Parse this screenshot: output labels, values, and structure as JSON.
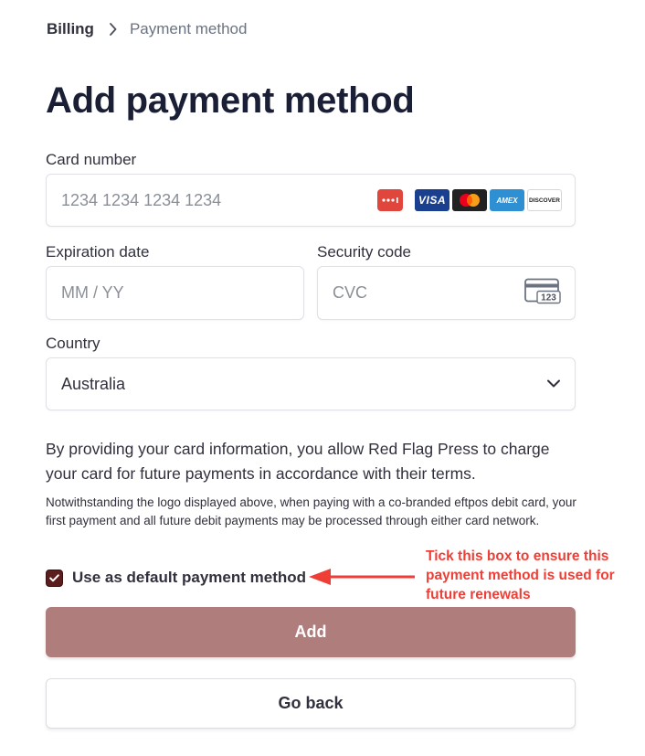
{
  "breadcrumb": {
    "root": "Billing",
    "current": "Payment method"
  },
  "page": {
    "title": "Add payment method"
  },
  "card_number": {
    "label": "Card number",
    "placeholder": "1234 1234 1234 1234",
    "brand_icons": [
      "eftpos-icon",
      "visa-icon",
      "mastercard-icon",
      "amex-icon",
      "discover-icon"
    ],
    "visa_text": "VISA",
    "amex_text": "AMEX",
    "discover_text": "DISCOVER"
  },
  "expiration": {
    "label": "Expiration date",
    "placeholder": "MM / YY"
  },
  "security_code": {
    "label": "Security code",
    "placeholder": "CVC",
    "icon_text": "123"
  },
  "country": {
    "label": "Country",
    "value": "Australia"
  },
  "terms": {
    "main": "By providing your card information, you allow Red Flag Press to charge your card for future payments in accordance with their terms.",
    "small": "Notwithstanding the logo displayed above, when paying with a co-branded eftpos debit card, your first payment and all future debit payments may be processed through either card network."
  },
  "default_checkbox": {
    "label": "Use as default payment method",
    "checked": true
  },
  "annotation": {
    "text": "Tick this box to ensure this payment method is used for future renewals",
    "color": "#ef3e36"
  },
  "buttons": {
    "add": "Add",
    "back": "Go back"
  },
  "colors": {
    "add_button": "#b07d7d",
    "checkbox": "#5c1d1d",
    "title": "#1a1f36"
  }
}
